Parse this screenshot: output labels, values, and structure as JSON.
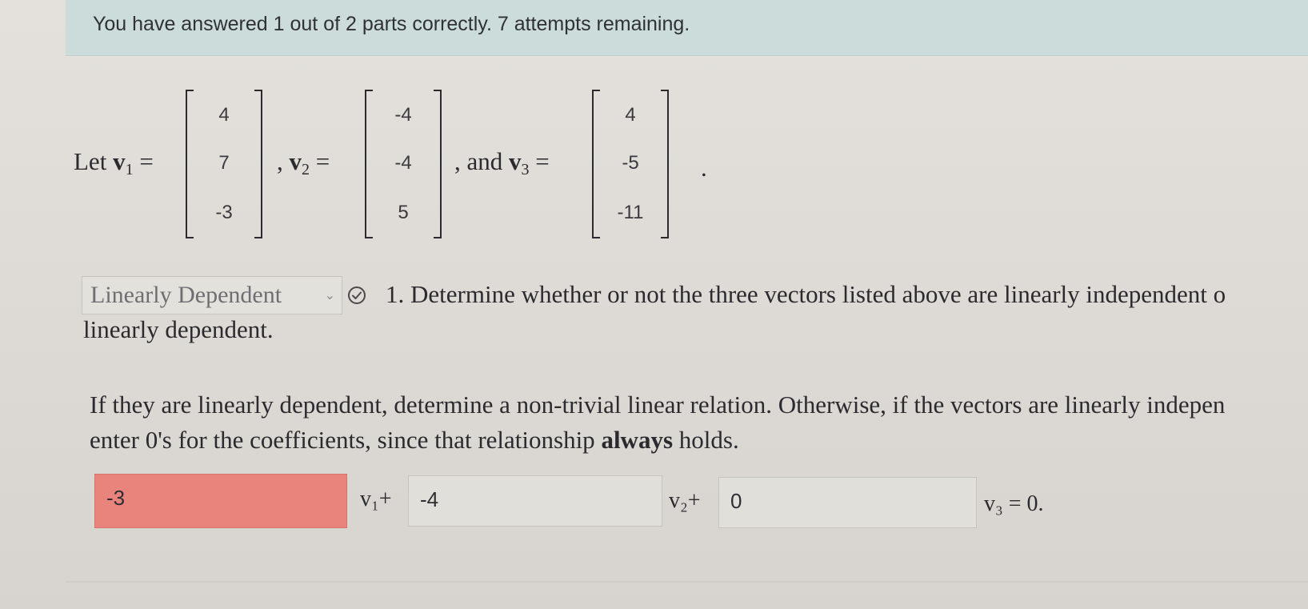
{
  "status": {
    "text": "You have answered 1 out of 2 parts correctly. 7 attempts remaining."
  },
  "vectors": {
    "let_label": "Let",
    "v1_name": "v",
    "v1_sub": "1",
    "v2_name": "v",
    "v2_sub": "2",
    "v3_name": "v",
    "v3_sub": "3",
    "equals": "=",
    "comma": ",",
    "and_text": ", and",
    "period": ".",
    "v1": [
      "4",
      "7",
      "-3"
    ],
    "v2": [
      "-4",
      "-4",
      "5"
    ],
    "v3": [
      "4",
      "-5",
      "-11"
    ]
  },
  "question1": {
    "selected": "Linearly Dependent",
    "status_icon": "check-circle-icon",
    "prompt_line1": "1. Determine whether or not the three vectors listed above are linearly independent o",
    "prompt_line2": "linearly dependent."
  },
  "question2": {
    "prompt_line1": "If they are linearly dependent, determine a non-trivial linear relation. Otherwise, if the vectors are linearly indepen",
    "prompt_line2_pre": "enter 0's for the coefficients, since that relationship ",
    "prompt_line2_bold": "always",
    "prompt_line2_post": " holds.",
    "coef1": "-3",
    "coef1_status": "incorrect",
    "coef2": "-4",
    "coef3": "0",
    "label_v1": "v₁+",
    "label_v2": "v₂+",
    "label_v3": "v₃ = 0."
  },
  "colors": {
    "status_bg": "#ccdcdb",
    "incorrect_bg": "#e8847b",
    "text": "#2b2a2e"
  }
}
